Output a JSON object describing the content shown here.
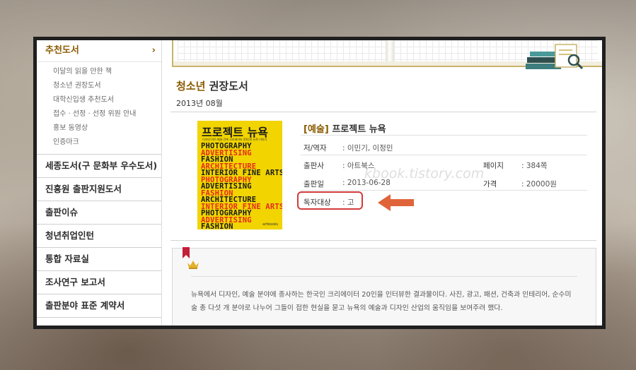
{
  "sidebar": {
    "header": "추천도서",
    "header_chevron": "›",
    "sub_items": [
      "이달의 읽을 만한 책",
      "청소년 권장도서",
      "대학신입생 추천도서",
      "접수 · 선정 · 선정 위원 안내",
      "홍보 동영상",
      "인증마크"
    ],
    "menu": [
      "세종도서(구 문화부 우수도서)",
      "진흥원 출판지원도서",
      "출판이슈",
      "청년취업인턴",
      "통합 자료실",
      "조사연구 보고서",
      "출판분야 표준 계약서"
    ]
  },
  "section": {
    "title_accent": "청소년",
    "title_rest": " 권장도서",
    "date": "2013년 08월"
  },
  "book": {
    "category": "[예술]",
    "title": "프로젝트 뉴욕",
    "author_label": "저/역자",
    "author": ": 이민기, 이정민",
    "publisher_label": "출판사",
    "publisher": ": 아트북스",
    "pubdate_label": "출판일",
    "pubdate": ": 2013-06-28",
    "pages_label": "페이지",
    "pages": ": 384쪽",
    "price_label": "가격",
    "price": ": 20000원",
    "reader_label": "독자대상",
    "reader": ": 고",
    "description": "뉴욕에서 디자인, 예술 분야에 종사하는 한국인 크리에이터 20인을 인터뷰한 결과물이다. 사진, 광고, 패션, 건축과 인테리어, 순수미술 총 다섯 개 분야로 나누어 그들이 접한 현실을 묻고 뉴욕의 예술과 디자인 산업의 움직임을 보여주려 했다."
  },
  "cover": {
    "title": "프로젝트 뉴욕",
    "subtitle": "디자인·아트·패션·건축 크리에이터 20인의 뉴욕 이야기",
    "lines": [
      "PHOTOGRAPHY",
      "ADVERTISING",
      "FASHION",
      "ARCHITECTURE",
      "INTERIOR FINE ARTS",
      "PHOTOGRAPHY",
      "ADVERTISING",
      "FASHION",
      "ARCHITECTURE",
      "INTERIOR FINE ARTS",
      "PHOTOGRAPHY",
      "ADVERTISING",
      "FASHION"
    ],
    "publisher_logo": "artbooks"
  },
  "watermark": "kbook.tistory.com",
  "colors": {
    "accent_brown": "#8a5a00",
    "cover_yellow": "#f1d400",
    "highlight_red": "#d33b3b",
    "arrow_orange": "#e0643a"
  }
}
